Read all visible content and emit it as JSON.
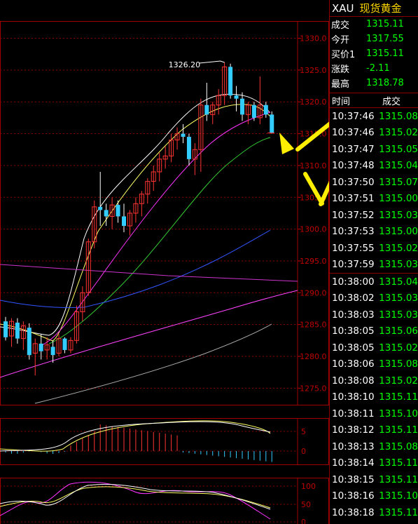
{
  "header": {
    "symbol": "XAU",
    "name": "现货黄金"
  },
  "quote": [
    {
      "label": "成交",
      "value": "1315.11"
    },
    {
      "label": "今开",
      "value": "1317.55"
    },
    {
      "label": "买价1",
      "value": "1315.11"
    },
    {
      "label": "涨跌",
      "value": "-2.11"
    },
    {
      "label": "最高",
      "value": "1318.78"
    }
  ],
  "ticks_header": {
    "time": "时间",
    "price": "成交"
  },
  "ticks": [
    {
      "time": "10:37:46",
      "price": "1315.08"
    },
    {
      "time": "10:37:46",
      "price": "1315.02"
    },
    {
      "time": "10:37:47",
      "price": "1315.05"
    },
    {
      "time": "10:37:48",
      "price": "1315.04"
    },
    {
      "time": "10:37:50",
      "price": "1315.07"
    },
    {
      "time": "10:37:51",
      "price": "1315.00"
    },
    {
      "time": "10:37:52",
      "price": "1315.03"
    },
    {
      "time": "10:37:53",
      "price": "1315.00"
    },
    {
      "time": "10:37:55",
      "price": "1315.02"
    },
    {
      "time": "10:37:59",
      "price": "1315.03"
    },
    {
      "time": "10:38:00",
      "price": "1315.04"
    },
    {
      "time": "10:38:02",
      "price": "1315.03"
    },
    {
      "time": "10:38:03",
      "price": "1315.03"
    },
    {
      "time": "10:38:05",
      "price": "1315.06"
    },
    {
      "time": "10:38:05",
      "price": "1315.02"
    },
    {
      "time": "10:38:06",
      "price": "1315.08"
    },
    {
      "time": "10:38:08",
      "price": "1315.02"
    },
    {
      "time": "10:38:10",
      "price": "1315.11"
    },
    {
      "time": "10:38:11",
      "price": "1315.10"
    },
    {
      "time": "10:38:12",
      "price": "1315.11"
    },
    {
      "time": "10:38:13",
      "price": "1315.08"
    },
    {
      "time": "10:38:14",
      "price": "1315.11"
    },
    {
      "time": "10:38:15",
      "price": "1315.11"
    },
    {
      "time": "10:38:16",
      "price": "1315.10"
    },
    {
      "time": "10:38:18",
      "price": "1315.11"
    }
  ],
  "chart_data": {
    "type": "candlestick",
    "y_range": [
      1270,
      1332
    ],
    "price_ticks": [
      "1330.0",
      "1325.0",
      "1320.0",
      "1315.0",
      "1310.0",
      "1305.0",
      "1300.0",
      "1295.0",
      "1290.0",
      "1285.0",
      "1280.0",
      "1275.0"
    ],
    "high_label": "1326.20",
    "candles": [
      [
        1285.5,
        1286.2,
        1282.5,
        1283.0
      ],
      [
        1283.2,
        1286.0,
        1281.5,
        1285.5
      ],
      [
        1285.3,
        1286.0,
        1282.0,
        1282.8
      ],
      [
        1282.8,
        1285.5,
        1281.0,
        1284.8
      ],
      [
        1284.5,
        1285.2,
        1279.5,
        1280.2
      ],
      [
        1280.5,
        1282.8,
        1277.0,
        1282.0
      ],
      [
        1282.0,
        1283.5,
        1279.5,
        1280.8
      ],
      [
        1281.0,
        1283.0,
        1279.5,
        1281.8
      ],
      [
        1281.5,
        1282.5,
        1279.0,
        1280.2
      ],
      [
        1280.5,
        1283.5,
        1280.0,
        1282.8
      ],
      [
        1282.8,
        1283.0,
        1280.5,
        1281.0
      ],
      [
        1281.0,
        1283.0,
        1280.5,
        1282.5
      ],
      [
        1282.5,
        1288.0,
        1282.0,
        1287.0
      ],
      [
        1287.0,
        1291.0,
        1285.5,
        1290.0
      ],
      [
        1290.0,
        1298.5,
        1289.5,
        1298.0
      ],
      [
        1298.0,
        1304.5,
        1297.0,
        1303.5
      ],
      [
        1303.5,
        1309.0,
        1300.5,
        1303.0
      ],
      [
        1303.0,
        1304.0,
        1300.5,
        1302.0
      ],
      [
        1302.0,
        1305.0,
        1300.0,
        1303.8
      ],
      [
        1303.8,
        1304.5,
        1301.0,
        1302.0
      ],
      [
        1302.0,
        1304.0,
        1299.5,
        1300.5
      ],
      [
        1300.5,
        1303.0,
        1299.0,
        1302.5
      ],
      [
        1302.5,
        1305.0,
        1301.0,
        1304.0
      ],
      [
        1304.0,
        1306.0,
        1302.0,
        1305.5
      ],
      [
        1305.5,
        1308.0,
        1304.0,
        1307.5
      ],
      [
        1307.5,
        1310.0,
        1306.0,
        1309.0
      ],
      [
        1309.0,
        1312.0,
        1307.5,
        1311.0
      ],
      [
        1311.0,
        1313.0,
        1309.5,
        1311.5
      ],
      [
        1311.5,
        1315.0,
        1310.5,
        1314.0
      ],
      [
        1314.0,
        1316.0,
        1312.5,
        1315.0
      ],
      [
        1315.0,
        1316.5,
        1313.5,
        1314.5
      ],
      [
        1314.5,
        1315.0,
        1310.0,
        1311.0
      ],
      [
        1311.0,
        1313.5,
        1308.5,
        1312.5
      ],
      [
        1312.5,
        1320.5,
        1309.0,
        1319.5
      ],
      [
        1319.5,
        1323.0,
        1317.0,
        1318.0
      ],
      [
        1318.0,
        1320.0,
        1316.5,
        1319.5
      ],
      [
        1319.5,
        1322.0,
        1318.0,
        1321.0
      ],
      [
        1321.0,
        1326.2,
        1319.5,
        1325.5
      ],
      [
        1325.5,
        1326.0,
        1320.5,
        1321.0
      ],
      [
        1321.0,
        1322.5,
        1318.5,
        1320.5
      ],
      [
        1320.5,
        1321.5,
        1317.0,
        1318.0
      ],
      [
        1318.0,
        1320.0,
        1316.5,
        1319.5
      ],
      [
        1319.5,
        1320.0,
        1317.0,
        1317.5
      ],
      [
        1317.5,
        1324.0,
        1316.5,
        1319.5
      ],
      [
        1319.5,
        1320.0,
        1317.5,
        1318.0
      ],
      [
        1318.0,
        1318.5,
        1315.0,
        1315.11
      ]
    ],
    "sub1_ticks": [
      "5",
      "0"
    ],
    "sub2_ticks": [
      "100",
      "50",
      "0"
    ]
  }
}
